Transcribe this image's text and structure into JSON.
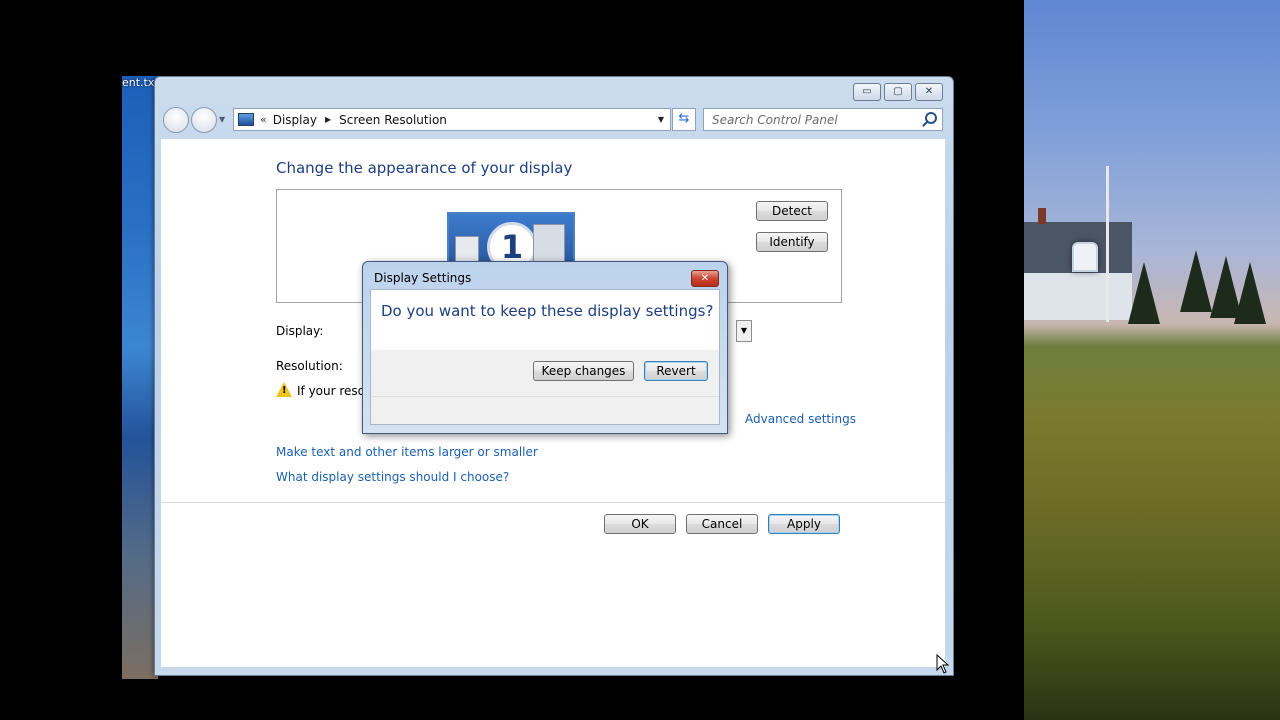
{
  "desktop": {
    "left_label": "ent.txt"
  },
  "window": {
    "caption_buttons": {
      "minimize": "▭",
      "maximize": "▢",
      "close": "✕"
    },
    "address": {
      "prefix": "«",
      "crumbs": [
        "Display",
        "Screen Resolution"
      ]
    },
    "search": {
      "placeholder": "Search Control Panel"
    }
  },
  "main": {
    "heading": "Change the appearance of your display",
    "monitor_number": "1",
    "detect_label": "Detect",
    "identify_label": "Identify",
    "display_label": "Display:",
    "resolution_label": "Resolution:",
    "warning_text": "If your resolu",
    "advanced_link": "Advanced settings",
    "links": [
      "Make text and other items larger or smaller",
      "What display settings should I choose?"
    ],
    "ok_label": "OK",
    "cancel_label": "Cancel",
    "apply_label": "Apply"
  },
  "dialog": {
    "title": "Display Settings",
    "question": "Do you want to keep these display settings?",
    "keep_label": "Keep changes",
    "revert_label": "Revert",
    "close_glyph": "✕"
  }
}
